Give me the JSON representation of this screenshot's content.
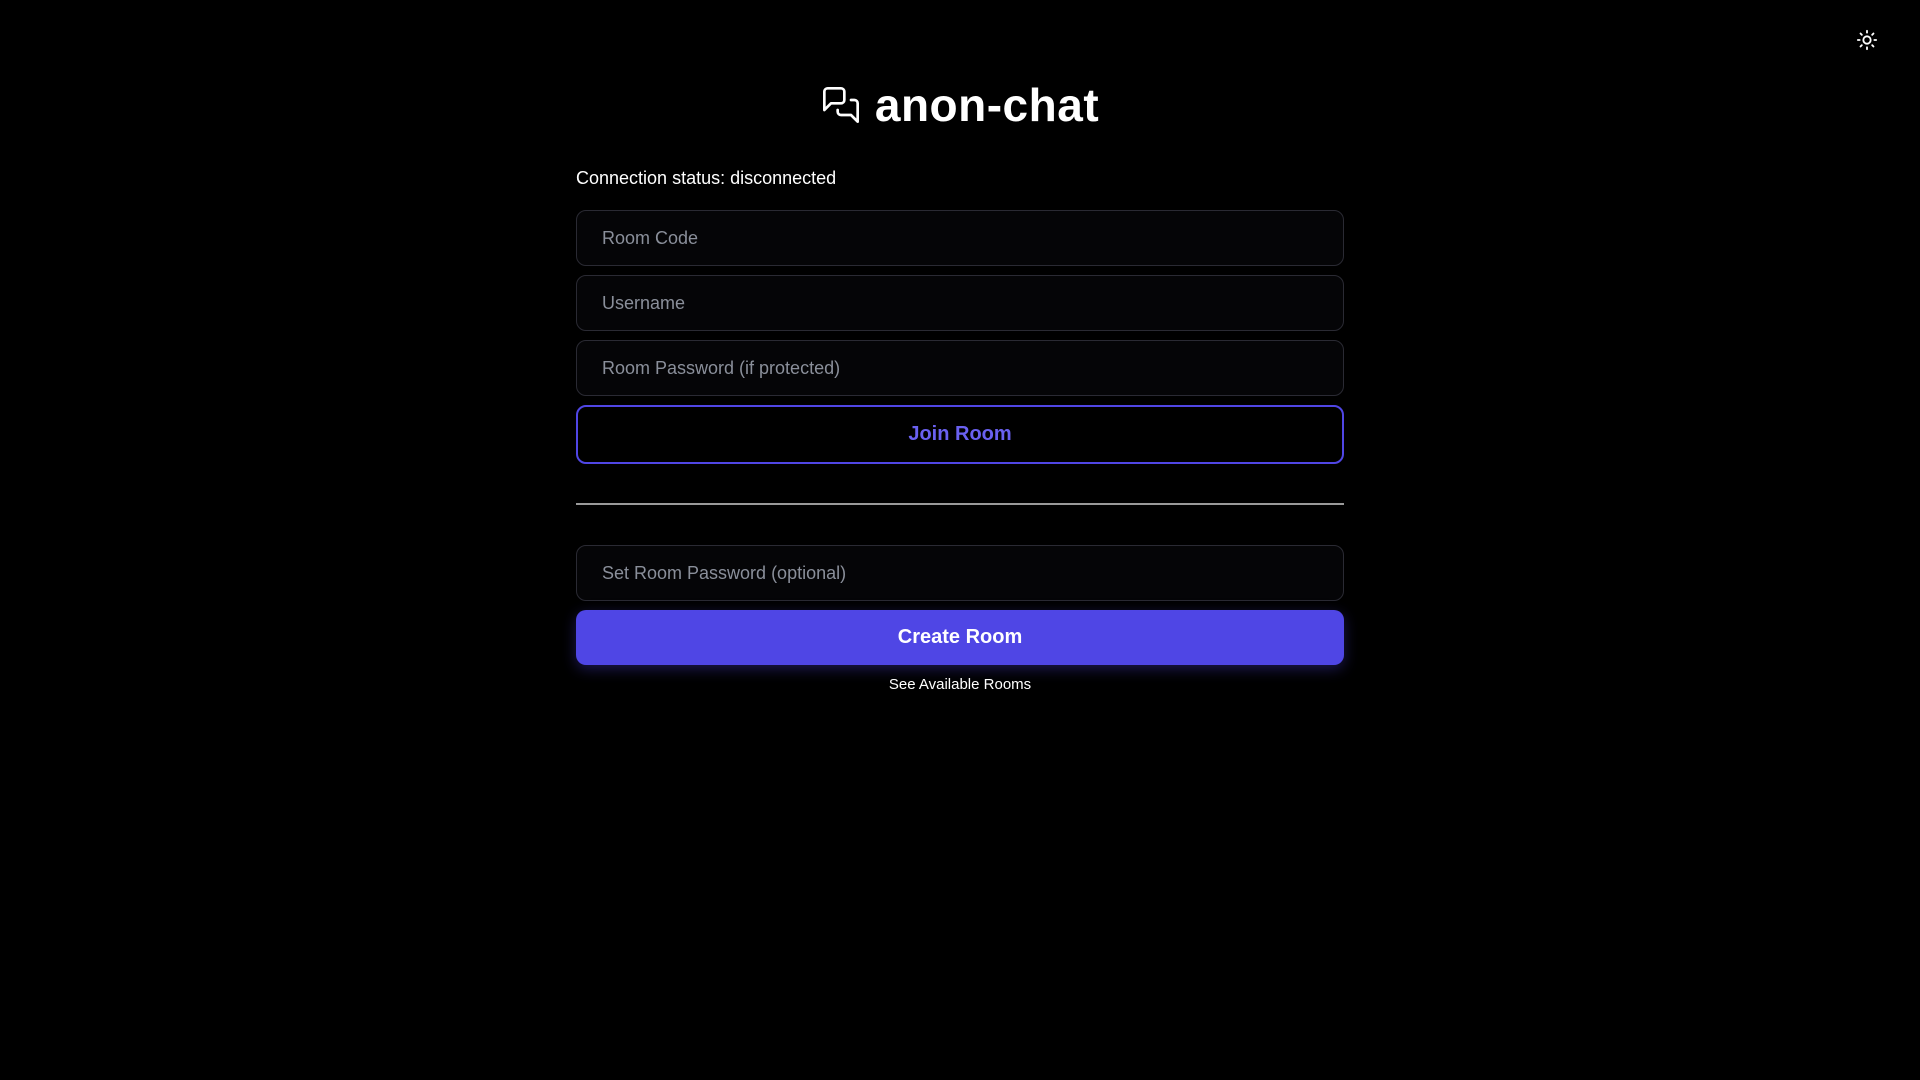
{
  "app": {
    "title": "anon-chat",
    "logo_icon": "chat-bubbles-icon",
    "theme_toggle_icon": "sun-icon"
  },
  "status": {
    "text": "Connection status: disconnected"
  },
  "join": {
    "room_code_placeholder": "Room Code",
    "username_placeholder": "Username",
    "password_placeholder": "Room Password (if protected)",
    "join_label": "Join Room"
  },
  "create": {
    "password_placeholder": "Set Room Password (optional)",
    "create_label": "Create Room",
    "see_rooms_label": "See Available Rooms"
  },
  "colors": {
    "background": "#000000",
    "accent": "#4f46e5",
    "accent_text": "#6a61f0",
    "placeholder": "#8a8f9a"
  }
}
